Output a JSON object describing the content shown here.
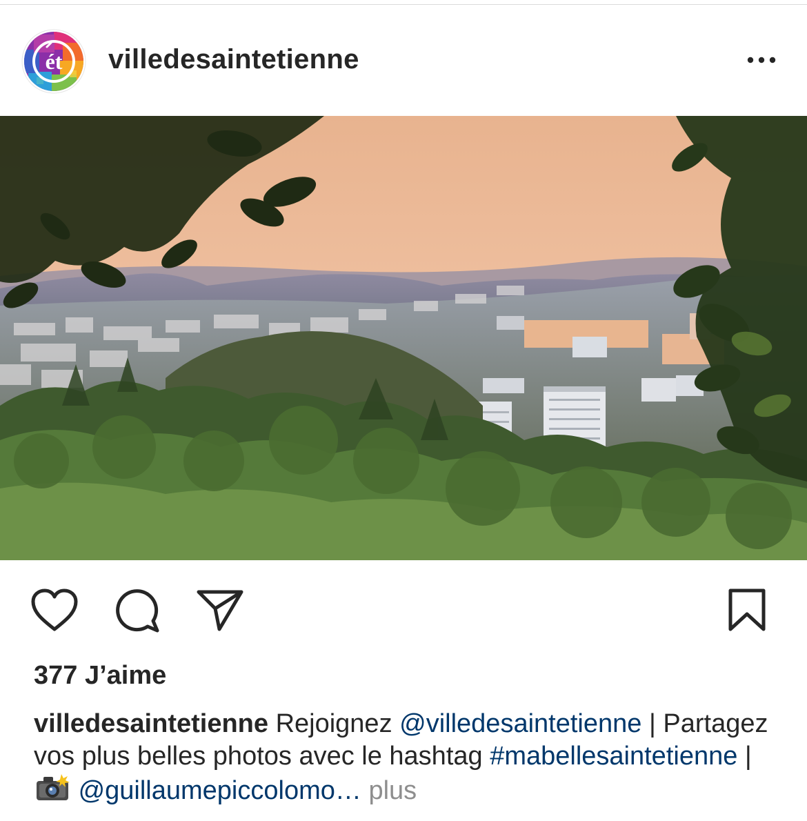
{
  "post": {
    "username": "villedesaintetienne",
    "avatar_icon": "ville-de-saint-etienne-logo",
    "more_icon": "more-options-icon",
    "photo_alt": "Vue de Saint-Étienne au coucher du soleil",
    "likes": "377 J’aime",
    "caption": {
      "user": "villedesaintetienne",
      "text1": " Rejoignez ",
      "mention1": "@villedesaintetienne",
      "text2": " | Partagez vos plus belles photos avec le hashtag ",
      "hashtag": "#mabellesaintetienne",
      "text3": " | ",
      "camera_icon": "camera-flash-emoji",
      "text4": " ",
      "mention2": "@guillaumepiccolomo…",
      "text5": " ",
      "more": "plus"
    }
  },
  "actions": {
    "like_icon": "heart-icon",
    "comment_icon": "comment-icon",
    "share_icon": "send-icon",
    "save_icon": "bookmark-icon"
  },
  "colors": {
    "link": "#00376b",
    "muted": "#8e8e8e",
    "text": "#262626"
  }
}
